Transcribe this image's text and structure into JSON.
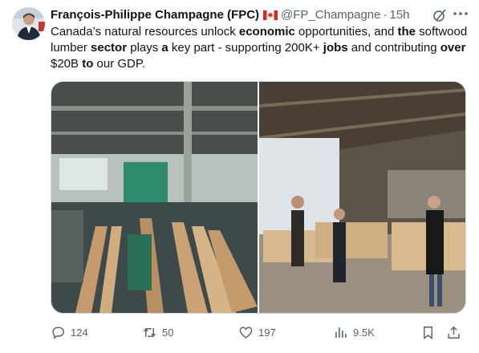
{
  "author": {
    "name": "François-Philippe Champagne (FPC)",
    "flag_icon": "canada-flag-icon",
    "handle": "@FP_Champagne",
    "separator": "·",
    "time": "15h"
  },
  "tweet": {
    "segments": [
      {
        "text": "Canada’s natural resources unlock ",
        "bold": false
      },
      {
        "text": "economic",
        "bold": true
      },
      {
        "text": " opportunities, and ",
        "bold": false
      },
      {
        "text": "the",
        "bold": true
      },
      {
        "text": " softwood lumber ",
        "bold": false
      },
      {
        "text": "sector",
        "bold": true
      },
      {
        "text": " plays ",
        "bold": false
      },
      {
        "text": "a",
        "bold": true
      },
      {
        "text": " key part - supporting 200K+ ",
        "bold": false
      },
      {
        "text": "jobs",
        "bold": true
      },
      {
        "text": " and contributing ",
        "bold": false
      },
      {
        "text": "over",
        "bold": true
      },
      {
        "text": " $20B ",
        "bold": false
      },
      {
        "text": "to",
        "bold": true
      },
      {
        "text": " our GDP.",
        "bold": false
      }
    ]
  },
  "stats": {
    "replies": "124",
    "retweets": "50",
    "likes": "197",
    "views": "9.5K"
  },
  "colors": {
    "text": "#0f1419",
    "muted": "#536471",
    "border": "#cfd9de"
  }
}
